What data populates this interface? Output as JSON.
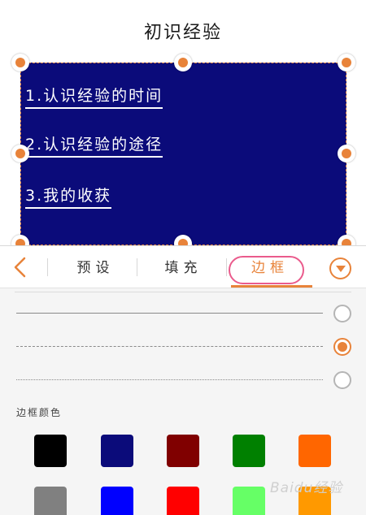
{
  "slide": {
    "title": "初识经验",
    "lines": [
      "1.认识经验的时间",
      "2.认识经验的途径",
      "3.我的收获"
    ],
    "box_color": "#0b0b7a",
    "handle_color": "#e8833a"
  },
  "toolbar": {
    "tabs": [
      {
        "label": "预设",
        "active": false
      },
      {
        "label": "填充",
        "active": false
      },
      {
        "label": "边框",
        "active": true
      }
    ],
    "accent": "#e8833a",
    "highlight_ring": "#ea5b8c"
  },
  "border_styles": [
    {
      "style": "solid",
      "selected": false
    },
    {
      "style": "dashed",
      "selected": true
    },
    {
      "style": "dotted",
      "selected": false
    }
  ],
  "border_color": {
    "label": "边框颜色",
    "swatches": [
      "#000000",
      "#0b0b7a",
      "#800000",
      "#008000",
      "#ff6600",
      "#808080",
      "#0000ff",
      "#ff0000",
      "#66ff66",
      "#ff9900"
    ]
  },
  "watermark": {
    "text": "Baidu经验"
  }
}
